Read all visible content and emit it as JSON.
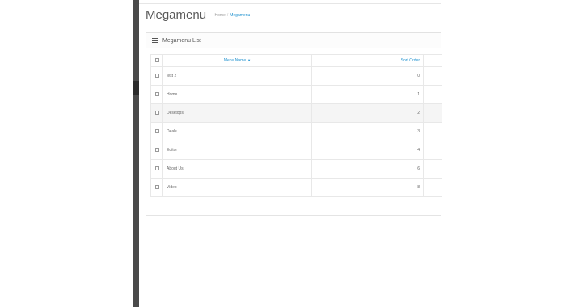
{
  "page": {
    "title": "Megamenu",
    "breadcrumb": [
      "Home",
      "Megamenu"
    ]
  },
  "panel": {
    "title": "Megamenu List",
    "icon": "list-icon"
  },
  "table": {
    "columns": {
      "name": "Menu Name",
      "sort": "Sort Order"
    },
    "sort_indicator": "chevron-down-icon",
    "rows": [
      {
        "name": "test 2",
        "sort": "0"
      },
      {
        "name": "Home",
        "sort": "1"
      },
      {
        "name": "Desktops",
        "sort": "2"
      },
      {
        "name": "Deals",
        "sort": "3"
      },
      {
        "name": "Editor",
        "sort": "4"
      },
      {
        "name": "About Us",
        "sort": "6"
      },
      {
        "name": "Video",
        "sort": "8"
      }
    ]
  },
  "colors": {
    "link": "#1e91cf",
    "sidebar": "#4a4a4a",
    "row_highlight": "#f5f5f5"
  }
}
